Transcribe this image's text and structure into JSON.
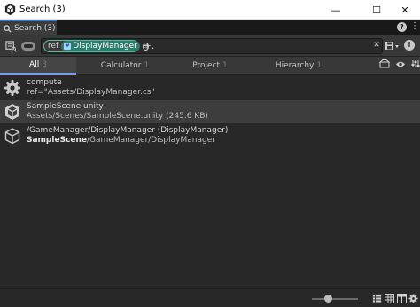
{
  "window": {
    "title": "Search (3)",
    "controls": {
      "minimize": "—",
      "maximize": "☐",
      "close": "✕"
    }
  },
  "tab": {
    "title": "Search (3)"
  },
  "search": {
    "chip_label": "ref",
    "chip_value": "DisplayManager",
    "add_filter": "+.",
    "clear": "✕"
  },
  "providers": [
    {
      "label": "All",
      "count": "3",
      "active": true
    },
    {
      "label": "Calculator",
      "count": "1",
      "active": false
    },
    {
      "label": "Project",
      "count": "1",
      "active": false
    },
    {
      "label": "Hierarchy",
      "count": "1",
      "active": false
    }
  ],
  "results": [
    {
      "icon": "gear-icon",
      "line1": "compute",
      "line2": "ref=\"Assets/DisplayManager.cs\"",
      "selected": false
    },
    {
      "icon": "unity-scene-icon",
      "line1": "SampleScene.unity",
      "line2": "Assets/Scenes/SampleScene.unity (245.6 KB)",
      "selected": true
    },
    {
      "icon": "gameobject-cube-icon",
      "line1": "/GameManager/DisplayManager (DisplayManager)",
      "line2_bold": "SampleScene",
      "line2_rest": "/GameManager/DisplayManager",
      "selected": false
    }
  ],
  "colors": {
    "accent": "#3a79bb",
    "chip_border": "#4bbf9f",
    "chip_fill": "#2d7c6b"
  },
  "status": {
    "item_size_level": 0.35
  }
}
